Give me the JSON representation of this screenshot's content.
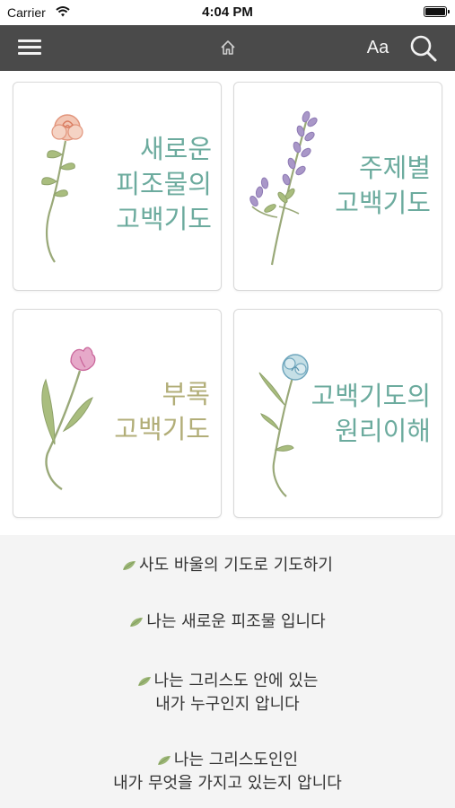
{
  "status_bar": {
    "carrier": "Carrier",
    "time": "4:04 PM"
  },
  "nav_bar": {
    "font_size_label": "Aa"
  },
  "cards": [
    {
      "lines": [
        "새로운",
        "피조물의",
        "고백기도"
      ],
      "text_color": "#6cab9e"
    },
    {
      "lines": [
        "주제별",
        "고백기도"
      ],
      "text_color": "#6cab9e"
    },
    {
      "lines": [
        "부록",
        "고백기도"
      ],
      "text_color": "#b2ae78"
    },
    {
      "lines": [
        "고백기도의",
        "원리이해"
      ],
      "text_color": "#6cab9e"
    }
  ],
  "links": [
    {
      "lines": [
        "사도 바울의 기도로 기도하기"
      ]
    },
    {
      "lines": [
        "나는 새로운 피조물 입니다"
      ]
    },
    {
      "lines": [
        "나는 그리스도 안에 있는",
        "내가 누구인지 압니다"
      ]
    },
    {
      "lines": [
        "나는 그리스도인인",
        "내가 무엇을 가지고 있는지 압니다"
      ]
    }
  ],
  "colors": {
    "nav_background": "#4a4a4a",
    "bottom_background": "#f4f4f4",
    "leaf": "#9cb676",
    "stem": "#9aa979"
  }
}
